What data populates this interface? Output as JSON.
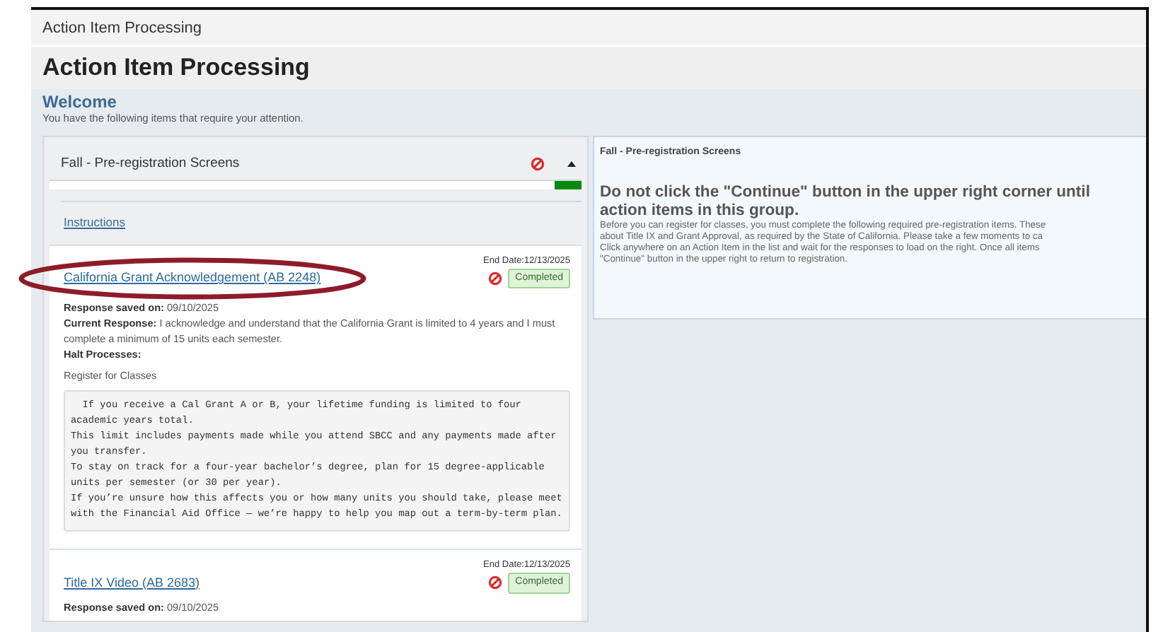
{
  "breadcrumb": "Action Item Processing",
  "page_title": "Action Item Processing",
  "welcome": {
    "heading": "Welcome",
    "text": "You have the following items that require your attention."
  },
  "group": {
    "title": "Fall - Pre-registration Screens",
    "expanded": true,
    "progress": {
      "level": 0.05
    },
    "instructions_link": "Instructions"
  },
  "items": [
    {
      "end_date": "End Date:12/13/2025",
      "title": "California Grant Acknowledgement (AB 2248)",
      "status": "Completed",
      "response_saved": "**Response saved on:** 09/10/2025",
      "current_response": "**Current Response:** I acknowledge and understand that the California Grant is limited to 4 years and I must complete a minimum of 15 units each semester.",
      "halt_label": "Halt Processes:",
      "halt_process": "Register for Classes",
      "note_lines": [
        "  If you receive a Cal Grant A or B, your lifetime funding is limited to four",
        "academic years total.",
        "This limit includes payments made while you attend SBCC and any payments made after",
        "you transfer.",
        "To stay on track for a four-year bachelor’s degree, plan for 15 degree-applicable",
        "units per semester (or 30 per year).",
        "If you’re unsure how this affects you or how many units you should take, please meet",
        "with the Financial Aid Office — we’re happy to help you map out a term-by-term plan."
      ],
      "circled": true
    },
    {
      "end_date": "End Date:12/13/2025",
      "title": "Title IX Video (AB 2683)",
      "status": "Completed",
      "response_saved": "**Response saved on:** 09/10/2025",
      "circled": false
    }
  ],
  "detail": {
    "group_title": "Fall - Pre-registration Screens",
    "heading_lines": [
      "Do not click the \"Continue\" button in the upper right corner until",
      "action items in this group."
    ],
    "paragraph_lines": [
      "Before you can register for classes, you must complete the following required pre-registration items. These",
      "about Title IX and Grant Approval, as required by the State of California. Please take a few moments to ca",
      "Click anywhere on an Action Item in the list and wait for the responses to load on the right. Once all items",
      "\"Continue\" button in the upper right to return to registration."
    ]
  }
}
